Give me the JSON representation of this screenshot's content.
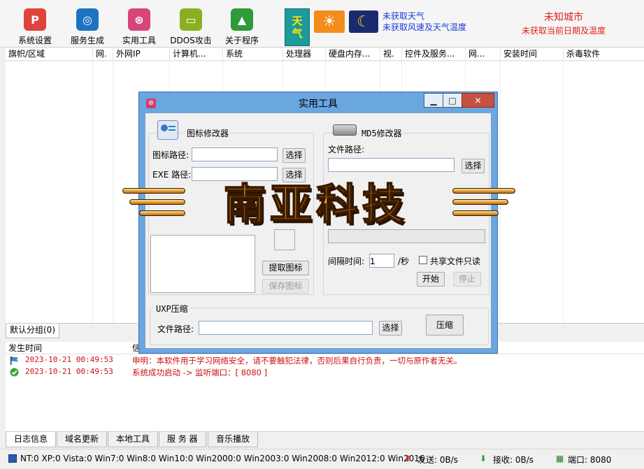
{
  "toolbar": {
    "buttons": [
      {
        "label": "系统设置",
        "icon": "pinterest-icon",
        "color": "#e0433a"
      },
      {
        "label": "服务生成",
        "icon": "globe-icon",
        "color": "#1c73c2"
      },
      {
        "label": "实用工具",
        "icon": "dribbble-icon",
        "color": "#d8457a"
      },
      {
        "label": "DDOS攻击",
        "icon": "ruler-icon",
        "color": "#8ab021"
      },
      {
        "label": "关于程序",
        "icon": "tree-icon",
        "color": "#2e9a3a"
      }
    ],
    "weather_tag": "天气",
    "weather_line1": "未获取天气",
    "weather_line2": "未获取风速及天气温度",
    "city": "未知城市",
    "city_sub": "未获取当前日期及温度"
  },
  "client_list": {
    "columns": [
      "旗帜/区域",
      "网.",
      "外网IP",
      "计算机...",
      "系统",
      "处理器",
      "硬盘内存...",
      "视.",
      "控件及服务...",
      "网...",
      "安装时间",
      "杀毒软件"
    ]
  },
  "group_tab": "默认分组(0)",
  "log": {
    "columns": [
      "发生时间",
      "信"
    ],
    "rows": [
      {
        "time": "2023-10-21 00:49:53",
        "message": "申明：本软件用于学习网络安全，请不要触犯法律，否则后果自行负责，一切与原作者无关。",
        "icon": "flag-icon"
      },
      {
        "time": "2023-10-21 00:49:53",
        "message": "系统成功启动 -> 监听端口：[ 8080 ]",
        "icon": "check-icon"
      }
    ]
  },
  "bottom_tabs": [
    "日志信息",
    "域名更新",
    "本地工具",
    "服 务 器",
    "音乐播放"
  ],
  "status": {
    "os_counts": "NT:0 XP:0 Vista:0 Win7:0 Win8:0 Win10:0 Win2000:0 Win2003:0 Win2008:0 Win2012:0 Win2016",
    "send": "发送: 0B/s",
    "recv": "接收: 0B/s",
    "port": "端口: 8080"
  },
  "dialog": {
    "title": "实用工具",
    "controls": {
      "minimize": "▁",
      "maximize": "□",
      "close": "✕"
    },
    "icon_modifier": {
      "title": "图标修改器",
      "icon_path_label": "图标路径:",
      "icon_path_value": "",
      "exe_path_label": "EXE 路径:",
      "exe_path_value": "",
      "select_label": "选择"
    },
    "md5_modifier": {
      "title": "MD5修改器",
      "file_path_label": "文件路径:",
      "file_path_value": "",
      "select_label": "选择"
    },
    "icon_extract": {
      "extract_label": "提取图标",
      "save_label": "保存图标"
    },
    "share": {
      "interval_label": "间隔时间:",
      "interval_value": "1",
      "unit": "/秒",
      "readonly_label": "共享文件只读",
      "start_label": "开始",
      "stop_label": "停止"
    },
    "upx": {
      "title": "UXP压缩",
      "file_path_label": "文件路径:",
      "file_path_value": "",
      "select_label": "选择",
      "compress_label": "压缩"
    }
  },
  "banner": {
    "text": "南亚科技"
  }
}
